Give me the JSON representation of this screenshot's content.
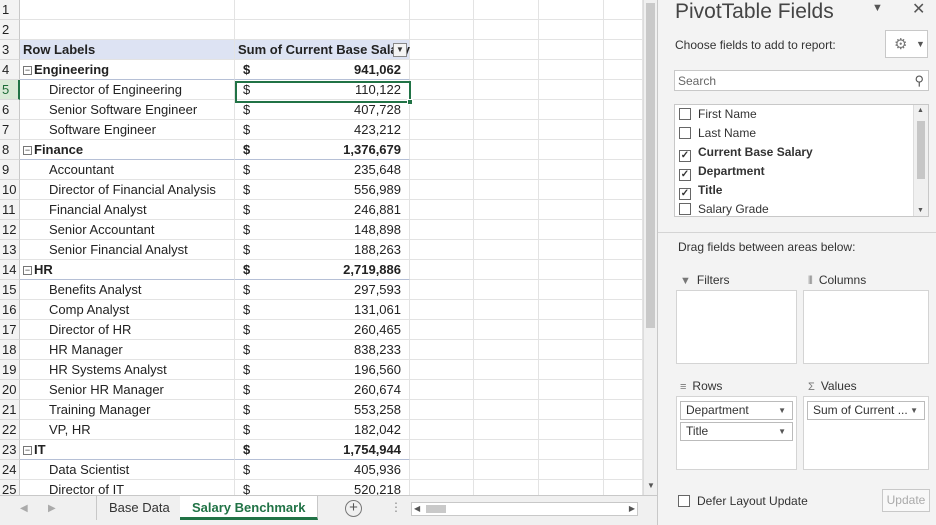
{
  "sheet": {
    "rows": [
      {
        "num": "1",
        "kind": "empty",
        "a": "",
        "dollar": "",
        "amount": ""
      },
      {
        "num": "2",
        "kind": "empty",
        "a": "",
        "dollar": "",
        "amount": ""
      },
      {
        "num": "3",
        "kind": "header",
        "a": "Row Labels",
        "b": "Sum of Current Base Salary"
      },
      {
        "num": "4",
        "kind": "group",
        "a": "Engineering",
        "dollar": "$",
        "amount": "941,062"
      },
      {
        "num": "5",
        "kind": "item",
        "a": "Director of Engineering",
        "dollar": "$",
        "amount": "110,122"
      },
      {
        "num": "6",
        "kind": "item",
        "a": "Senior Software Engineer",
        "dollar": "$",
        "amount": "407,728"
      },
      {
        "num": "7",
        "kind": "item",
        "a": "Software Engineer",
        "dollar": "$",
        "amount": "423,212"
      },
      {
        "num": "8",
        "kind": "group",
        "a": "Finance",
        "dollar": "$",
        "amount": "1,376,679"
      },
      {
        "num": "9",
        "kind": "item",
        "a": "Accountant",
        "dollar": "$",
        "amount": "235,648"
      },
      {
        "num": "10",
        "kind": "item",
        "a": "Director of Financial Analysis",
        "dollar": "$",
        "amount": "556,989"
      },
      {
        "num": "11",
        "kind": "item",
        "a": "Financial Analyst",
        "dollar": "$",
        "amount": "246,881"
      },
      {
        "num": "12",
        "kind": "item",
        "a": "Senior Accountant",
        "dollar": "$",
        "amount": "148,898"
      },
      {
        "num": "13",
        "kind": "item",
        "a": "Senior Financial Analyst",
        "dollar": "$",
        "amount": "188,263"
      },
      {
        "num": "14",
        "kind": "group",
        "a": "HR",
        "dollar": "$",
        "amount": "2,719,886"
      },
      {
        "num": "15",
        "kind": "item",
        "a": "Benefits Analyst",
        "dollar": "$",
        "amount": "297,593"
      },
      {
        "num": "16",
        "kind": "item",
        "a": "Comp Analyst",
        "dollar": "$",
        "amount": "131,061"
      },
      {
        "num": "17",
        "kind": "item",
        "a": "Director of HR",
        "dollar": "$",
        "amount": "260,465"
      },
      {
        "num": "18",
        "kind": "item",
        "a": "HR Manager",
        "dollar": "$",
        "amount": "838,233"
      },
      {
        "num": "19",
        "kind": "item",
        "a": "HR Systems Analyst",
        "dollar": "$",
        "amount": "196,560"
      },
      {
        "num": "20",
        "kind": "item",
        "a": "Senior HR Manager",
        "dollar": "$",
        "amount": "260,674"
      },
      {
        "num": "21",
        "kind": "item",
        "a": "Training Manager",
        "dollar": "$",
        "amount": "553,258"
      },
      {
        "num": "22",
        "kind": "item",
        "a": "VP, HR",
        "dollar": "$",
        "amount": "182,042"
      },
      {
        "num": "23",
        "kind": "group",
        "a": "IT",
        "dollar": "$",
        "amount": "1,754,944"
      },
      {
        "num": "24",
        "kind": "item",
        "a": "Data Scientist",
        "dollar": "$",
        "amount": "405,936"
      },
      {
        "num": "25",
        "kind": "item",
        "a": "Director of IT",
        "dollar": "$",
        "amount": "520,218"
      }
    ],
    "collapse_symbol": "−",
    "tabs": [
      "Base Data",
      "Salary Benchmark"
    ],
    "active_tab": "Salary Benchmark"
  },
  "pane": {
    "title": "PivotTable Fields",
    "choose_label": "Choose fields to add to report:",
    "search_placeholder": "Search",
    "fields": [
      {
        "label": "First Name",
        "checked": false
      },
      {
        "label": "Last Name",
        "checked": false
      },
      {
        "label": "Current Base Salary",
        "checked": true
      },
      {
        "label": "Department",
        "checked": true
      },
      {
        "label": "Title",
        "checked": true
      },
      {
        "label": "Salary Grade",
        "checked": false
      }
    ],
    "drag_label": "Drag fields between areas below:",
    "areas": {
      "filters": "Filters",
      "columns": "Columns",
      "rows": "Rows",
      "values": "Values"
    },
    "rows_fields": [
      "Department",
      "Title"
    ],
    "values_fields": [
      "Sum of Current ..."
    ],
    "defer_label": "Defer Layout Update",
    "update_label": "Update"
  }
}
